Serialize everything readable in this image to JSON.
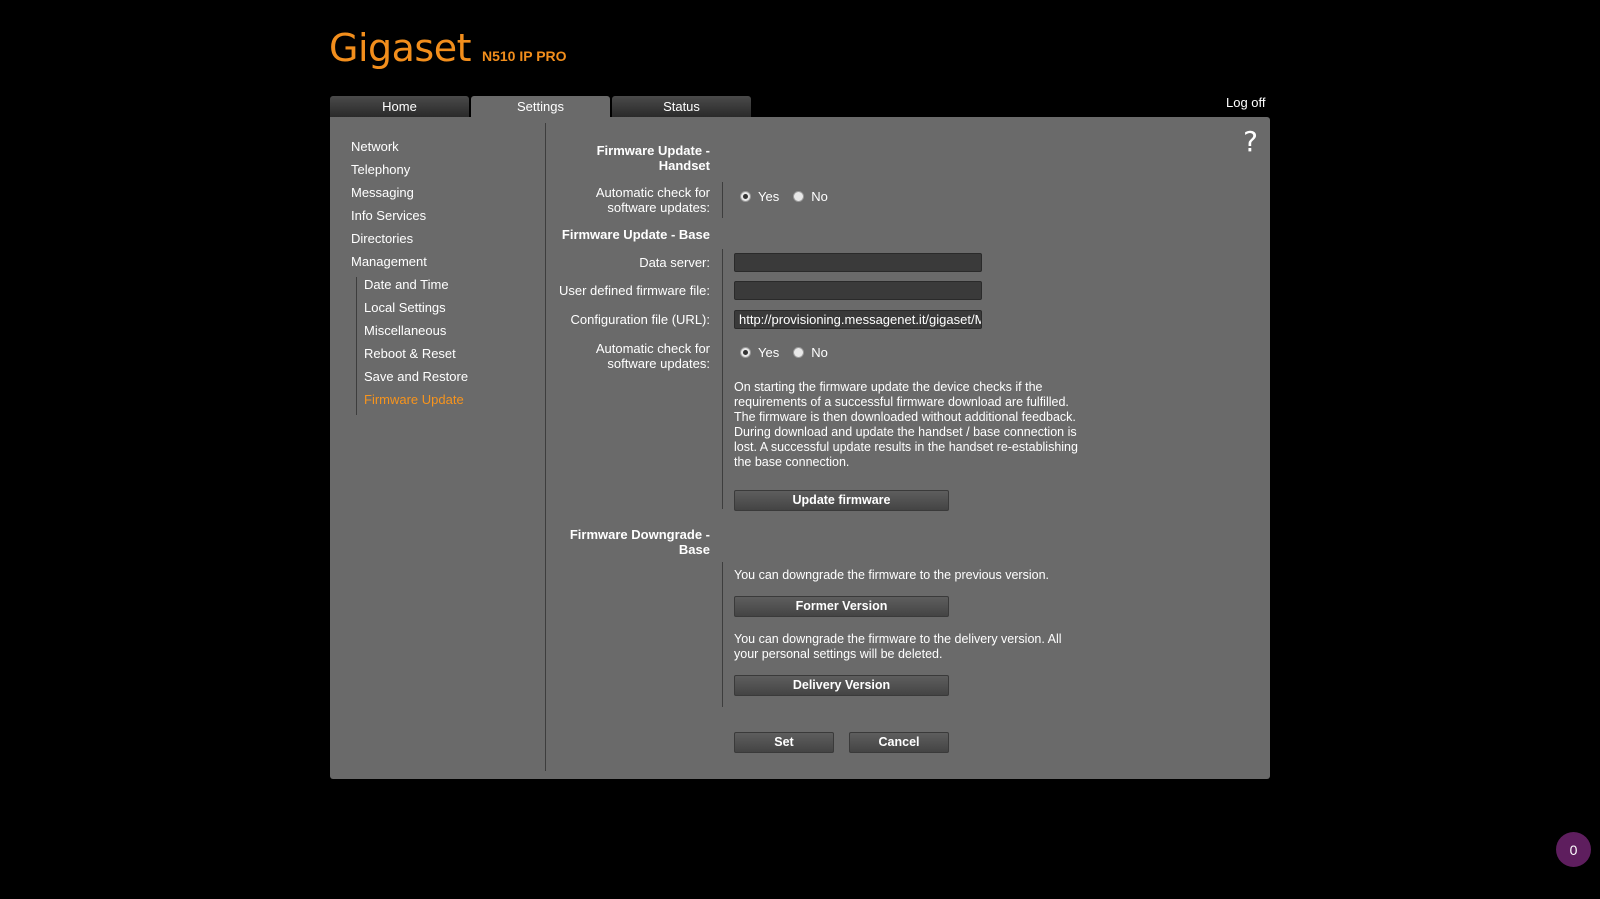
{
  "brand": {
    "logo": "Gigaset",
    "model": "N510 IP PRO"
  },
  "tabs": [
    "Home",
    "Settings",
    "Status"
  ],
  "logoff": "Log off",
  "help": "?",
  "sidebar": {
    "items": [
      "Network",
      "Telephony",
      "Messaging",
      "Info Services",
      "Directories",
      "Management"
    ],
    "subitems": [
      "Date and Time",
      "Local Settings",
      "Miscellaneous",
      "Reboot & Reset",
      "Save and Restore",
      "Firmware Update"
    ]
  },
  "handset": {
    "title": "Firmware Update - Handset",
    "auto_check_label": "Automatic check for software updates:",
    "yes": "Yes",
    "no": "No"
  },
  "base": {
    "title": "Firmware Update - Base",
    "data_server_label": "Data server:",
    "data_server_value": "",
    "firmware_file_label": "User defined firmware file:",
    "firmware_file_value": "",
    "config_file_label": "Configuration file (URL):",
    "config_file_value": "http://provisioning.messagenet.it/gigaset/Mess",
    "auto_check_label": "Automatic check for software updates:",
    "yes": "Yes",
    "no": "No",
    "info": "On starting the firmware update the device checks if the requirements of a successful firmware download are fulfilled. The firmware is then downloaded without additional feedback. During download and update the handset / base connection is lost. A successful update results in the handset re-establishing the base connection.",
    "update_button": "Update firmware"
  },
  "downgrade": {
    "title": "Firmware Downgrade - Base",
    "former_text": "You can downgrade the firmware to the previous version.",
    "former_button": "Former Version",
    "delivery_text": "You can downgrade the firmware to the delivery version. All your personal settings will be deleted.",
    "delivery_button": "Delivery Version"
  },
  "actions": {
    "set": "Set",
    "cancel": "Cancel"
  },
  "badge": "0",
  "colors": {
    "accent": "#f28e1c",
    "panel": "#6a6a6a",
    "background": "#000000"
  }
}
